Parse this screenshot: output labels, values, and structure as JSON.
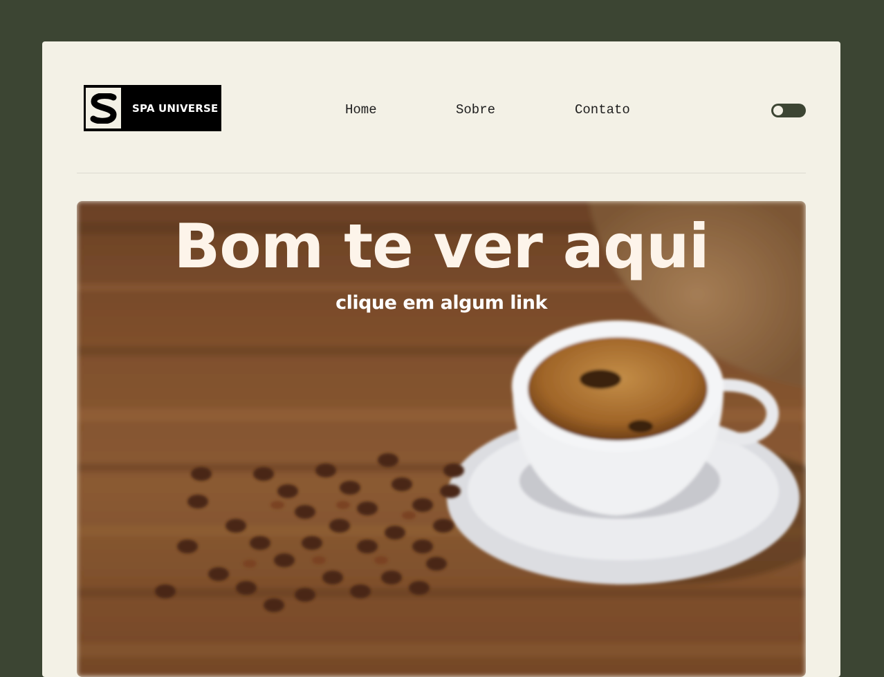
{
  "brand": {
    "name": "SPA UNIVERSE",
    "mark": "S"
  },
  "nav": {
    "items": [
      {
        "label": "Home"
      },
      {
        "label": "Sobre"
      },
      {
        "label": "Contato"
      }
    ]
  },
  "theme_toggle": {
    "icon": "toggle-switch-icon",
    "state": "off"
  },
  "hero": {
    "title": "Bom te ver aqui",
    "subtitle": "clique em algum link",
    "image": "coffee-cup-and-beans-photo"
  },
  "colors": {
    "background": "#3c4533",
    "card": "#f3f1e6",
    "text": "#1d1d1d",
    "hero_text": "#fdf4ea"
  }
}
